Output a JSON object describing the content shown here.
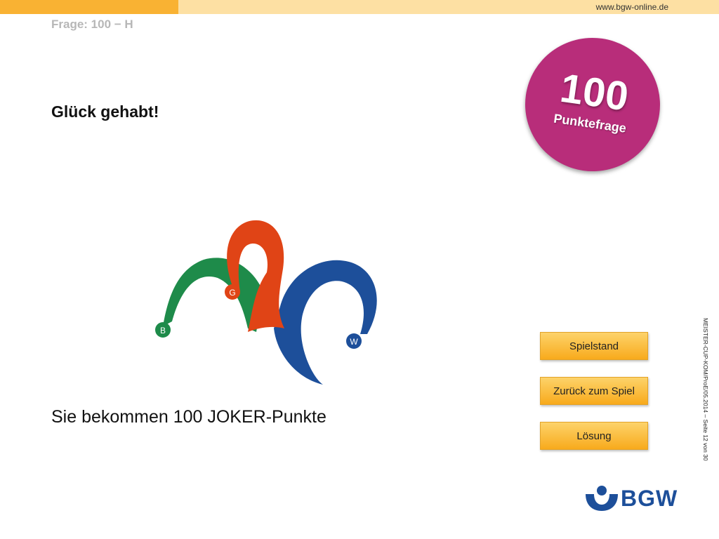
{
  "header": {
    "website": "www.bgw-online.de",
    "question_label": "Frage: 100 − H"
  },
  "main": {
    "heading": "Glück gehabt!",
    "joker_text": "Sie bekommen 100 JOKER-Punkte"
  },
  "badge": {
    "number": "100",
    "label": "Punktefrage"
  },
  "joker_logo": {
    "letters": [
      "B",
      "G",
      "W"
    ],
    "colors": {
      "green": "#1e8b4a",
      "red": "#e04416",
      "blue": "#1d4f9a"
    }
  },
  "buttons": {
    "score": "Spielstand",
    "back": "Zurück zum Spiel",
    "solution": "Lösung"
  },
  "footer": {
    "vertical_text": "MEISTER-CUP-KOM/ProE/05.2014 – Seite 12 von 30",
    "logo_text": "BGW"
  },
  "colors": {
    "accent": "#f9b233",
    "badge": "#b82d7a",
    "brand_blue": "#1d4f9a"
  }
}
